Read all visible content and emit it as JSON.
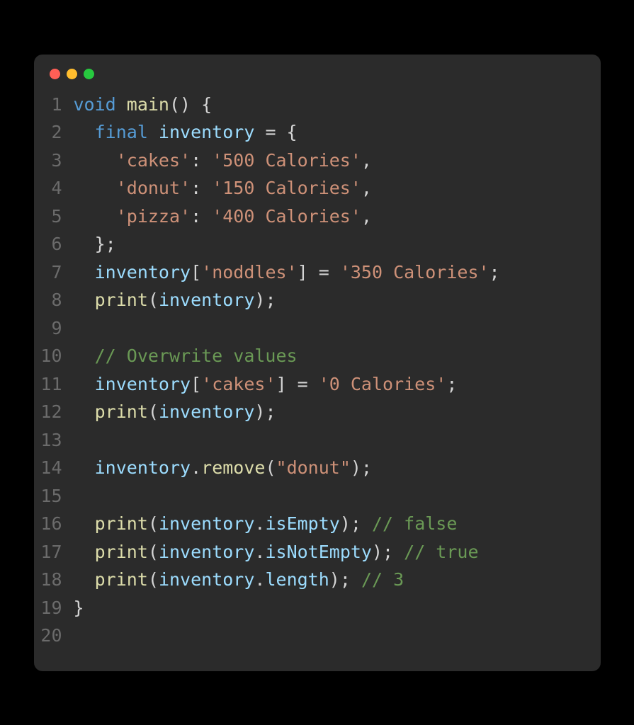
{
  "traffic_lights": {
    "red": "#ff5f56",
    "yellow": "#ffbd2e",
    "green": "#27c93f"
  },
  "lines": [
    {
      "no": "1",
      "tokens": [
        {
          "t": "void ",
          "c": "kw-type"
        },
        {
          "t": "main",
          "c": "fn-name"
        },
        {
          "t": "() {",
          "c": "punct"
        }
      ]
    },
    {
      "no": "2",
      "tokens": [
        {
          "t": "  ",
          "c": "punct"
        },
        {
          "t": "final ",
          "c": "kw-ctrl"
        },
        {
          "t": "inventory",
          "c": "ident"
        },
        {
          "t": " = {",
          "c": "punct"
        }
      ]
    },
    {
      "no": "3",
      "tokens": [
        {
          "t": "    ",
          "c": "punct"
        },
        {
          "t": "'cakes'",
          "c": "str"
        },
        {
          "t": ": ",
          "c": "punct"
        },
        {
          "t": "'500 Calories'",
          "c": "str"
        },
        {
          "t": ",",
          "c": "punct"
        }
      ]
    },
    {
      "no": "4",
      "tokens": [
        {
          "t": "    ",
          "c": "punct"
        },
        {
          "t": "'donut'",
          "c": "str"
        },
        {
          "t": ": ",
          "c": "punct"
        },
        {
          "t": "'150 Calories'",
          "c": "str"
        },
        {
          "t": ",",
          "c": "punct"
        }
      ]
    },
    {
      "no": "5",
      "tokens": [
        {
          "t": "    ",
          "c": "punct"
        },
        {
          "t": "'pizza'",
          "c": "str"
        },
        {
          "t": ": ",
          "c": "punct"
        },
        {
          "t": "'400 Calories'",
          "c": "str"
        },
        {
          "t": ",",
          "c": "punct"
        }
      ]
    },
    {
      "no": "6",
      "tokens": [
        {
          "t": "  };",
          "c": "punct"
        }
      ]
    },
    {
      "no": "7",
      "tokens": [
        {
          "t": "  ",
          "c": "punct"
        },
        {
          "t": "inventory",
          "c": "ident"
        },
        {
          "t": "[",
          "c": "punct"
        },
        {
          "t": "'noddles'",
          "c": "str"
        },
        {
          "t": "] = ",
          "c": "punct"
        },
        {
          "t": "'350 Calories'",
          "c": "str"
        },
        {
          "t": ";",
          "c": "punct"
        }
      ]
    },
    {
      "no": "8",
      "tokens": [
        {
          "t": "  ",
          "c": "punct"
        },
        {
          "t": "print",
          "c": "fn-call"
        },
        {
          "t": "(",
          "c": "punct"
        },
        {
          "t": "inventory",
          "c": "ident"
        },
        {
          "t": ");",
          "c": "punct"
        }
      ]
    },
    {
      "no": "9",
      "tokens": []
    },
    {
      "no": "10",
      "tokens": [
        {
          "t": "  ",
          "c": "punct"
        },
        {
          "t": "// Overwrite values",
          "c": "comment"
        }
      ]
    },
    {
      "no": "11",
      "tokens": [
        {
          "t": "  ",
          "c": "punct"
        },
        {
          "t": "inventory",
          "c": "ident"
        },
        {
          "t": "[",
          "c": "punct"
        },
        {
          "t": "'cakes'",
          "c": "str"
        },
        {
          "t": "] = ",
          "c": "punct"
        },
        {
          "t": "'0 Calories'",
          "c": "str"
        },
        {
          "t": ";",
          "c": "punct"
        }
      ]
    },
    {
      "no": "12",
      "tokens": [
        {
          "t": "  ",
          "c": "punct"
        },
        {
          "t": "print",
          "c": "fn-call"
        },
        {
          "t": "(",
          "c": "punct"
        },
        {
          "t": "inventory",
          "c": "ident"
        },
        {
          "t": ");",
          "c": "punct"
        }
      ]
    },
    {
      "no": "13",
      "tokens": []
    },
    {
      "no": "14",
      "tokens": [
        {
          "t": "  ",
          "c": "punct"
        },
        {
          "t": "inventory",
          "c": "ident"
        },
        {
          "t": ".",
          "c": "punct"
        },
        {
          "t": "remove",
          "c": "fn-call"
        },
        {
          "t": "(",
          "c": "punct"
        },
        {
          "t": "\"donut\"",
          "c": "str"
        },
        {
          "t": ");",
          "c": "punct"
        }
      ]
    },
    {
      "no": "15",
      "tokens": []
    },
    {
      "no": "16",
      "tokens": [
        {
          "t": "  ",
          "c": "punct"
        },
        {
          "t": "print",
          "c": "fn-call"
        },
        {
          "t": "(",
          "c": "punct"
        },
        {
          "t": "inventory",
          "c": "ident"
        },
        {
          "t": ".",
          "c": "punct"
        },
        {
          "t": "isEmpty",
          "c": "prop"
        },
        {
          "t": "); ",
          "c": "punct"
        },
        {
          "t": "// false",
          "c": "comment"
        }
      ]
    },
    {
      "no": "17",
      "tokens": [
        {
          "t": "  ",
          "c": "punct"
        },
        {
          "t": "print",
          "c": "fn-call"
        },
        {
          "t": "(",
          "c": "punct"
        },
        {
          "t": "inventory",
          "c": "ident"
        },
        {
          "t": ".",
          "c": "punct"
        },
        {
          "t": "isNotEmpty",
          "c": "prop"
        },
        {
          "t": "); ",
          "c": "punct"
        },
        {
          "t": "// true",
          "c": "comment"
        }
      ]
    },
    {
      "no": "18",
      "tokens": [
        {
          "t": "  ",
          "c": "punct"
        },
        {
          "t": "print",
          "c": "fn-call"
        },
        {
          "t": "(",
          "c": "punct"
        },
        {
          "t": "inventory",
          "c": "ident"
        },
        {
          "t": ".",
          "c": "punct"
        },
        {
          "t": "length",
          "c": "prop"
        },
        {
          "t": "); ",
          "c": "punct"
        },
        {
          "t": "// 3",
          "c": "comment"
        }
      ]
    },
    {
      "no": "19",
      "tokens": [
        {
          "t": "}",
          "c": "punct"
        }
      ]
    },
    {
      "no": "20",
      "tokens": []
    }
  ]
}
